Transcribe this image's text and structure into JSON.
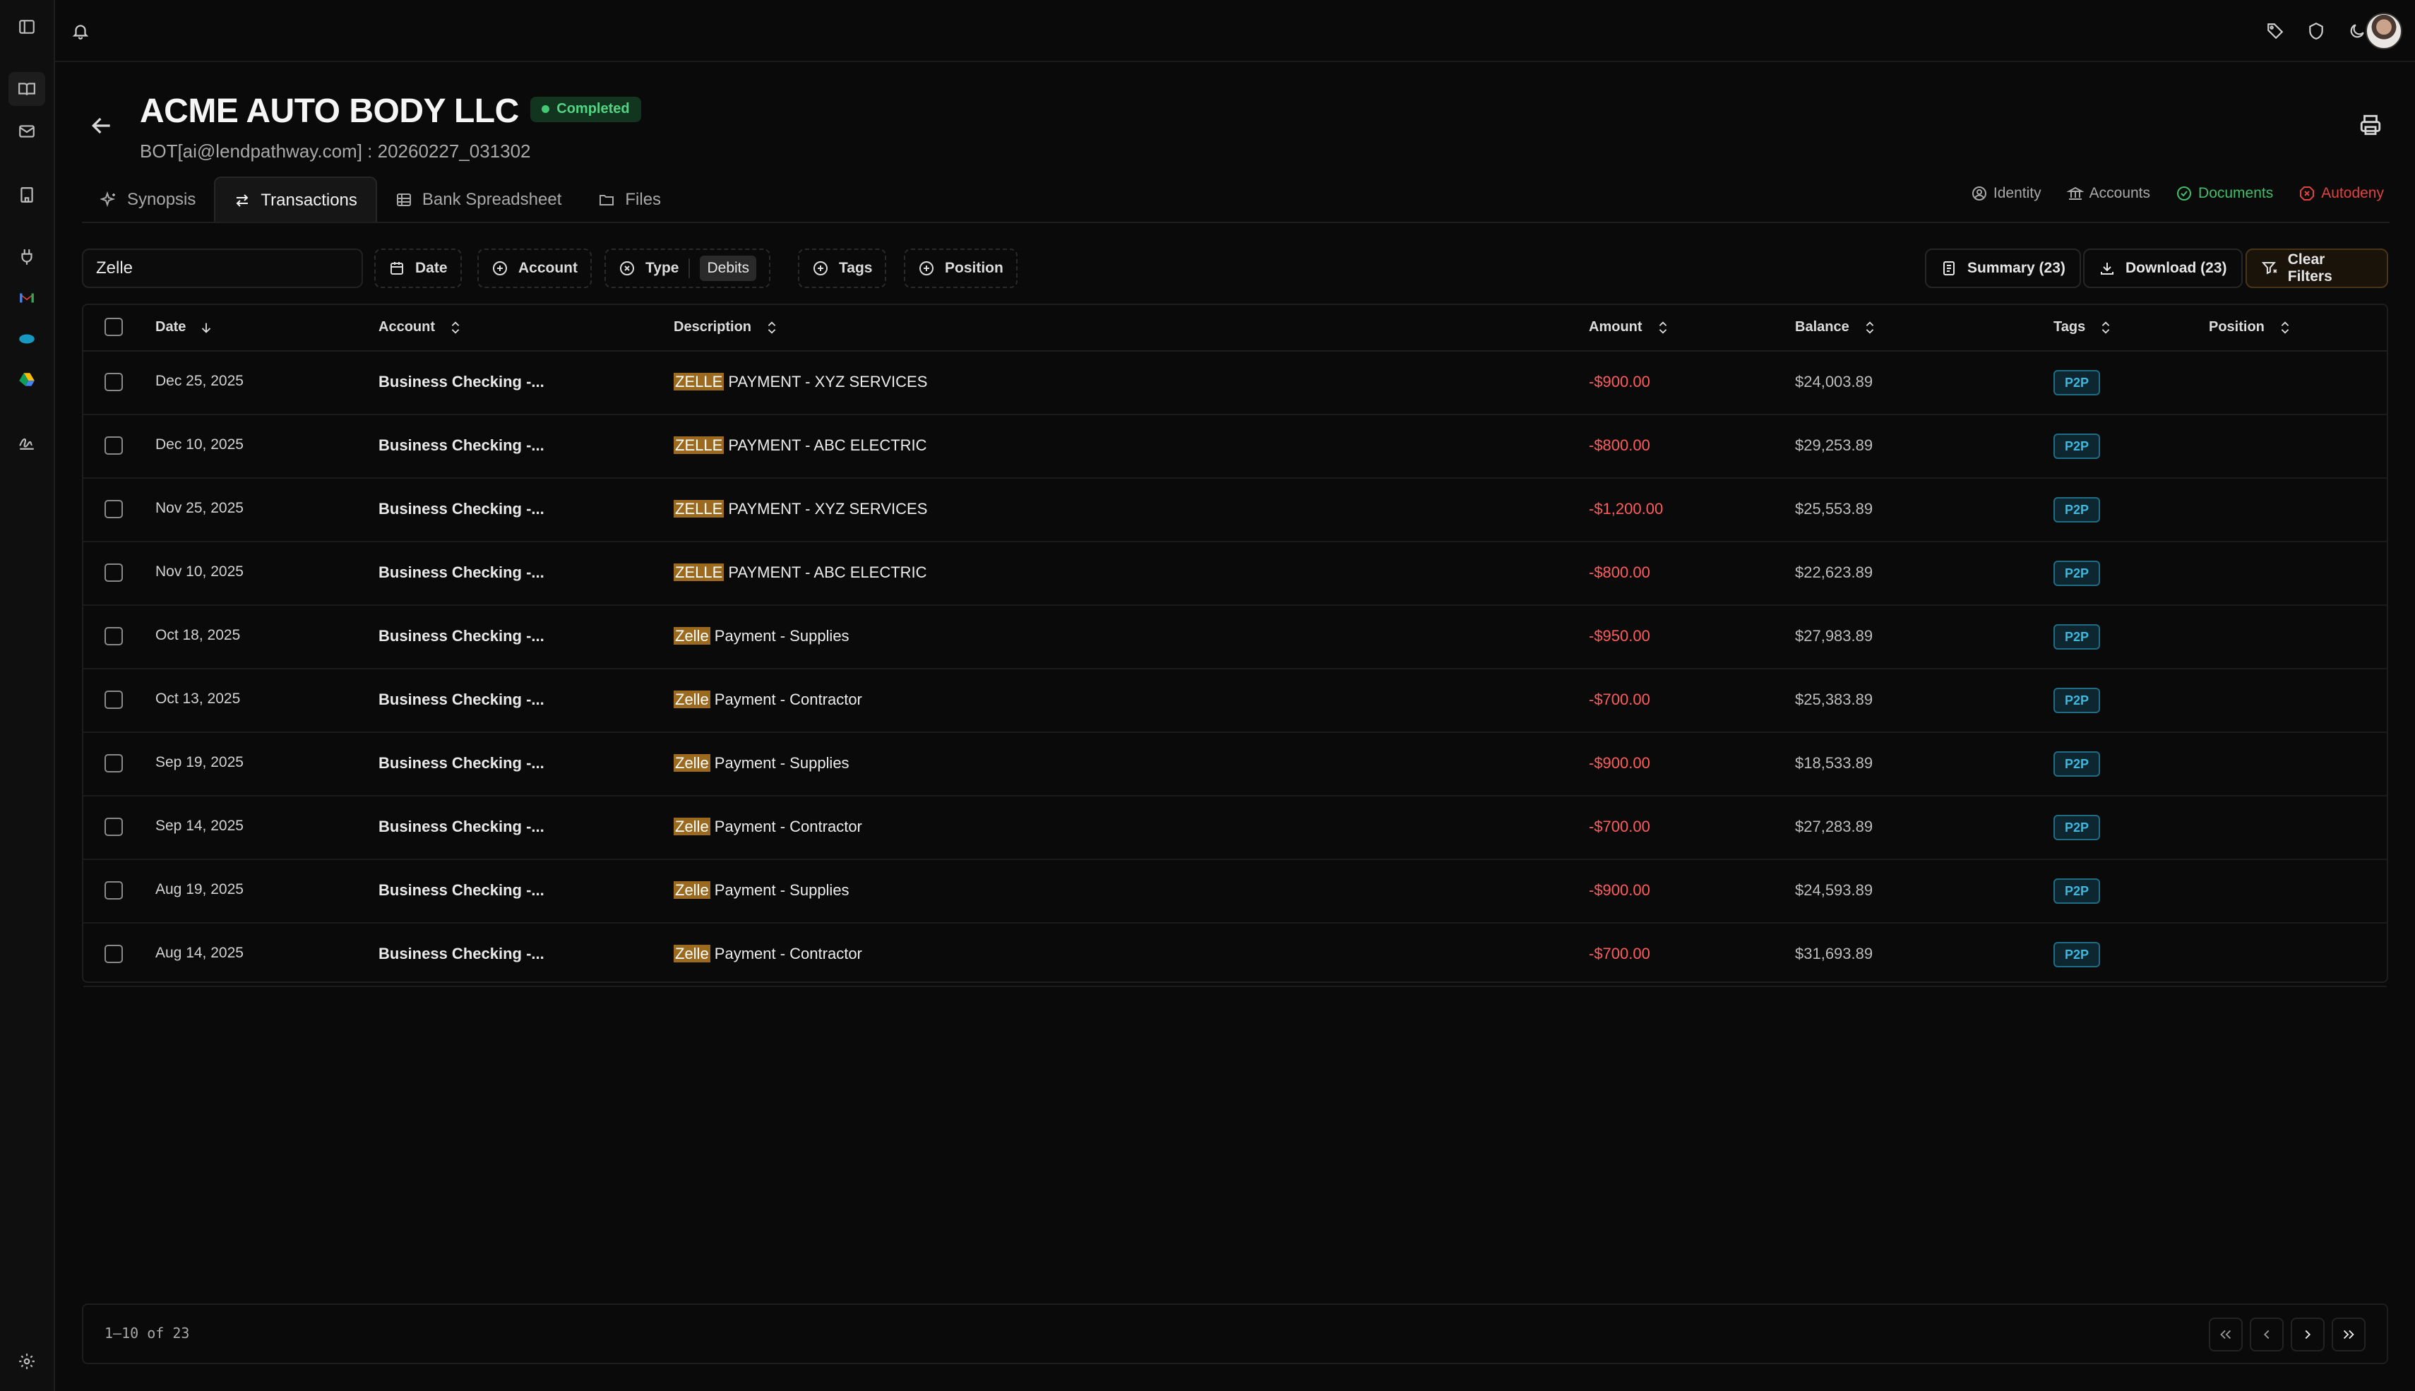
{
  "company": {
    "title": "ACME AUTO BODY LLC",
    "status": "Completed",
    "subtitle": "BOT[ai@lendpathway.com] : 20260227_031302"
  },
  "tabs": [
    {
      "label": "Synopsis",
      "icon": "sparkle-icon",
      "active": false
    },
    {
      "label": "Transactions",
      "icon": "arrows-swap-icon",
      "active": true
    },
    {
      "label": "Bank Spreadsheet",
      "icon": "table-icon",
      "active": false
    },
    {
      "label": "Files",
      "icon": "folder-icon",
      "active": false
    }
  ],
  "right_links": [
    {
      "label": "Identity",
      "color": "#a8a8a8",
      "icon": "user-circle-icon"
    },
    {
      "label": "Accounts",
      "color": "#a8a8a8",
      "icon": "bank-icon"
    },
    {
      "label": "Documents",
      "color": "#3fbf6a",
      "icon": "check-circle-icon"
    },
    {
      "label": "Autodeny",
      "color": "#e0423e",
      "icon": "x-octagon-icon"
    }
  ],
  "filters": {
    "search_value": "Zelle",
    "chips": [
      {
        "label": "Date",
        "icon": "calendar-icon"
      },
      {
        "label": "Account",
        "icon": "plus-circle-icon"
      },
      {
        "label": "Type",
        "icon": "x-circle-icon",
        "value": "Debits"
      },
      {
        "label": "Tags",
        "icon": "plus-circle-icon"
      },
      {
        "label": "Position",
        "icon": "plus-circle-icon"
      }
    ],
    "summary_label": "Summary (23)",
    "download_label": "Download (23)",
    "clear_label": "Clear Filters"
  },
  "table": {
    "headers": {
      "date": "Date",
      "account": "Account",
      "description": "Description",
      "amount": "Amount",
      "balance": "Balance",
      "tags": "Tags",
      "position": "Position"
    },
    "rows": [
      {
        "date": "Dec 25, 2025",
        "account": "Business Checking -...",
        "hl": "ZELLE",
        "rest": " PAYMENT - XYZ SERVICES",
        "amount": "-$900.00",
        "balance": "$24,003.89",
        "tag": "P2P"
      },
      {
        "date": "Dec 10, 2025",
        "account": "Business Checking -...",
        "hl": "ZELLE",
        "rest": " PAYMENT - ABC ELECTRIC",
        "amount": "-$800.00",
        "balance": "$29,253.89",
        "tag": "P2P"
      },
      {
        "date": "Nov 25, 2025",
        "account": "Business Checking -...",
        "hl": "ZELLE",
        "rest": " PAYMENT - XYZ SERVICES",
        "amount": "-$1,200.00",
        "balance": "$25,553.89",
        "tag": "P2P"
      },
      {
        "date": "Nov 10, 2025",
        "account": "Business Checking -...",
        "hl": "ZELLE",
        "rest": " PAYMENT - ABC ELECTRIC",
        "amount": "-$800.00",
        "balance": "$22,623.89",
        "tag": "P2P"
      },
      {
        "date": "Oct 18, 2025",
        "account": "Business Checking -...",
        "hl": "Zelle",
        "rest": " Payment - Supplies",
        "amount": "-$950.00",
        "balance": "$27,983.89",
        "tag": "P2P"
      },
      {
        "date": "Oct 13, 2025",
        "account": "Business Checking -...",
        "hl": "Zelle",
        "rest": " Payment - Contractor",
        "amount": "-$700.00",
        "balance": "$25,383.89",
        "tag": "P2P"
      },
      {
        "date": "Sep 19, 2025",
        "account": "Business Checking -...",
        "hl": "Zelle",
        "rest": " Payment - Supplies",
        "amount": "-$900.00",
        "balance": "$18,533.89",
        "tag": "P2P"
      },
      {
        "date": "Sep 14, 2025",
        "account": "Business Checking -...",
        "hl": "Zelle",
        "rest": " Payment - Contractor",
        "amount": "-$700.00",
        "balance": "$27,283.89",
        "tag": "P2P"
      },
      {
        "date": "Aug 19, 2025",
        "account": "Business Checking -...",
        "hl": "Zelle",
        "rest": " Payment - Supplies",
        "amount": "-$900.00",
        "balance": "$24,593.89",
        "tag": "P2P"
      },
      {
        "date": "Aug 14, 2025",
        "account": "Business Checking -...",
        "hl": "Zelle",
        "rest": " Payment - Contractor",
        "amount": "-$700.00",
        "balance": "$31,693.89",
        "tag": "P2P"
      }
    ]
  },
  "pagination": {
    "label": "1–10 of 23"
  },
  "colors": {
    "accent_green": "#52d482",
    "debit_red": "#ff5c5c",
    "tag_blue": "#3bb9e0",
    "highlight": "#9b6a1e"
  }
}
